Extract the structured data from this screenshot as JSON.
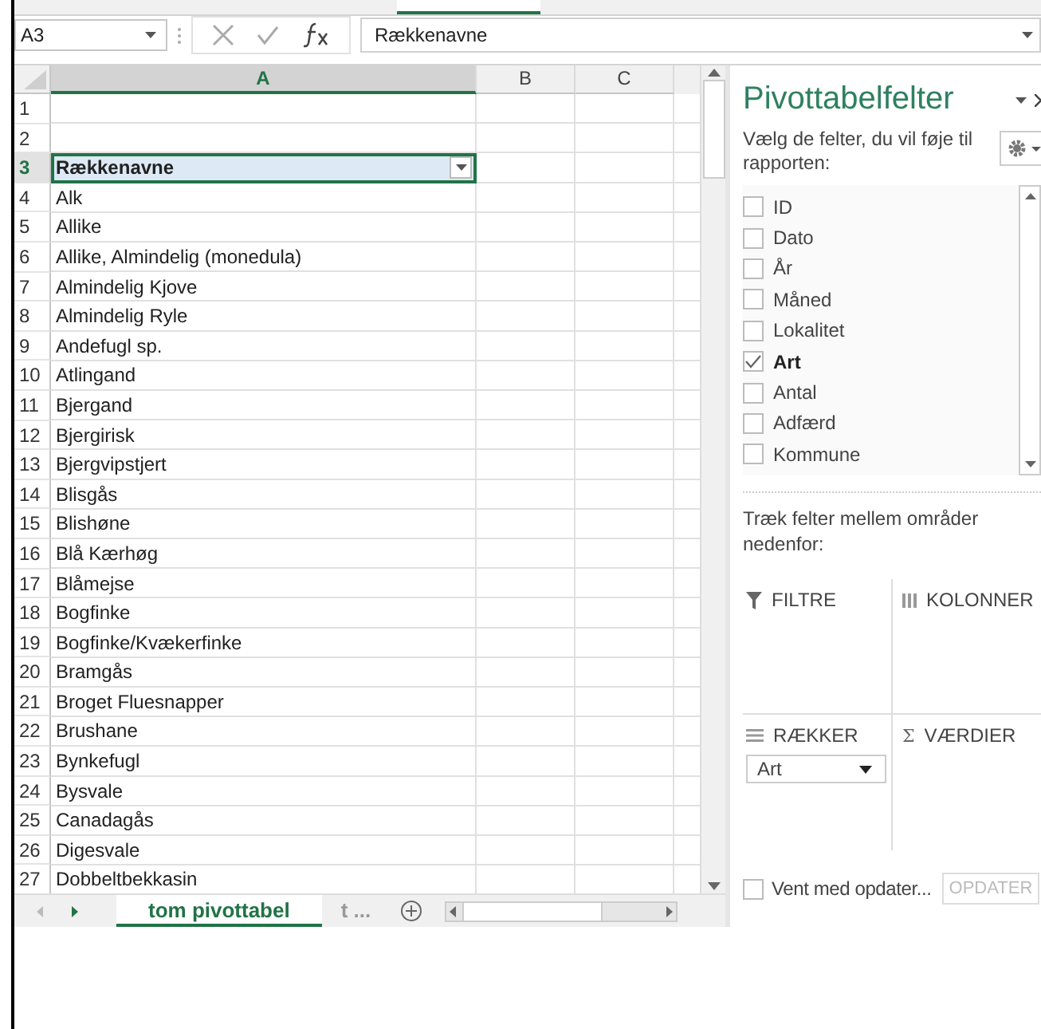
{
  "name_box": "A3",
  "formula_bar": {
    "value": "Rækkenavne"
  },
  "columns": [
    {
      "label": "A",
      "selected": true
    },
    {
      "label": "B",
      "selected": false
    },
    {
      "label": "C",
      "selected": false
    }
  ],
  "rows": [
    {
      "number": "1",
      "selected": false
    },
    {
      "number": "2",
      "selected": false
    },
    {
      "number": "3",
      "cell": "Rækkenavne",
      "kind": "header",
      "selected": true
    },
    {
      "number": "4",
      "cell": "Alk",
      "selected": false
    },
    {
      "number": "5",
      "cell": "Allike",
      "selected": false
    },
    {
      "number": "6",
      "cell": "Allike, Almindelig (monedula)",
      "selected": false
    },
    {
      "number": "7",
      "cell": "Almindelig Kjove",
      "selected": false
    },
    {
      "number": "8",
      "cell": "Almindelig Ryle",
      "selected": false
    },
    {
      "number": "9",
      "cell": "Andefugl sp.",
      "selected": false
    },
    {
      "number": "10",
      "cell": "Atlingand",
      "selected": false
    },
    {
      "number": "11",
      "cell": "Bjergand",
      "selected": false
    },
    {
      "number": "12",
      "cell": "Bjergirisk",
      "selected": false
    },
    {
      "number": "13",
      "cell": "Bjergvipstjert",
      "selected": false
    },
    {
      "number": "14",
      "cell": "Blisgås",
      "selected": false
    },
    {
      "number": "15",
      "cell": "Blishøne",
      "selected": false
    },
    {
      "number": "16",
      "cell": "Blå Kærhøg",
      "selected": false
    },
    {
      "number": "17",
      "cell": "Blåmejse",
      "selected": false
    },
    {
      "number": "18",
      "cell": "Bogfinke",
      "selected": false
    },
    {
      "number": "19",
      "cell": "Bogfinke/Kvækerfinke",
      "selected": false
    },
    {
      "number": "20",
      "cell": "Bramgås",
      "selected": false
    },
    {
      "number": "21",
      "cell": "Broget Fluesnapper",
      "selected": false
    },
    {
      "number": "22",
      "cell": "Brushane",
      "selected": false
    },
    {
      "number": "23",
      "cell": "Bynkefugl",
      "selected": false
    },
    {
      "number": "24",
      "cell": "Bysvale",
      "selected": false
    },
    {
      "number": "25",
      "cell": "Canadagås",
      "selected": false
    },
    {
      "number": "26",
      "cell": "Digesvale",
      "selected": false
    },
    {
      "number": "27",
      "cell": "Dobbeltbekkasin",
      "selected": false
    }
  ],
  "sheet_tabs": [
    {
      "label": "tom pivottabel",
      "selected": true
    },
    {
      "label": "t ...",
      "selected": false
    }
  ],
  "pivot": {
    "title": "Pivottabelfelter",
    "instruction": "Vælg de felter, du vil føje til rapporten:",
    "fields": [
      {
        "label": "ID",
        "checked": false
      },
      {
        "label": "Dato",
        "checked": false
      },
      {
        "label": "År",
        "checked": false
      },
      {
        "label": "Måned",
        "checked": false
      },
      {
        "label": "Lokalitet",
        "checked": false
      },
      {
        "label": "Art",
        "checked": true
      },
      {
        "label": "Antal",
        "checked": false
      },
      {
        "label": "Adfærd",
        "checked": false
      },
      {
        "label": "Kommune",
        "checked": false
      }
    ],
    "drag_hint": "Træk felter mellem områder nedenfor:",
    "areas": [
      {
        "kind": "filter",
        "label": "FILTRE"
      },
      {
        "kind": "columns",
        "label": "KOLONNER"
      },
      {
        "kind": "rows",
        "label": "RÆKKER",
        "items": [
          "Art"
        ]
      },
      {
        "kind": "values",
        "icon": "Σ",
        "label": "VÆRDIER"
      }
    ],
    "defer_update": {
      "label": "Vent med opdater...",
      "checked": false
    },
    "update_button": {
      "label": "OPDATER",
      "disabled": true
    }
  }
}
